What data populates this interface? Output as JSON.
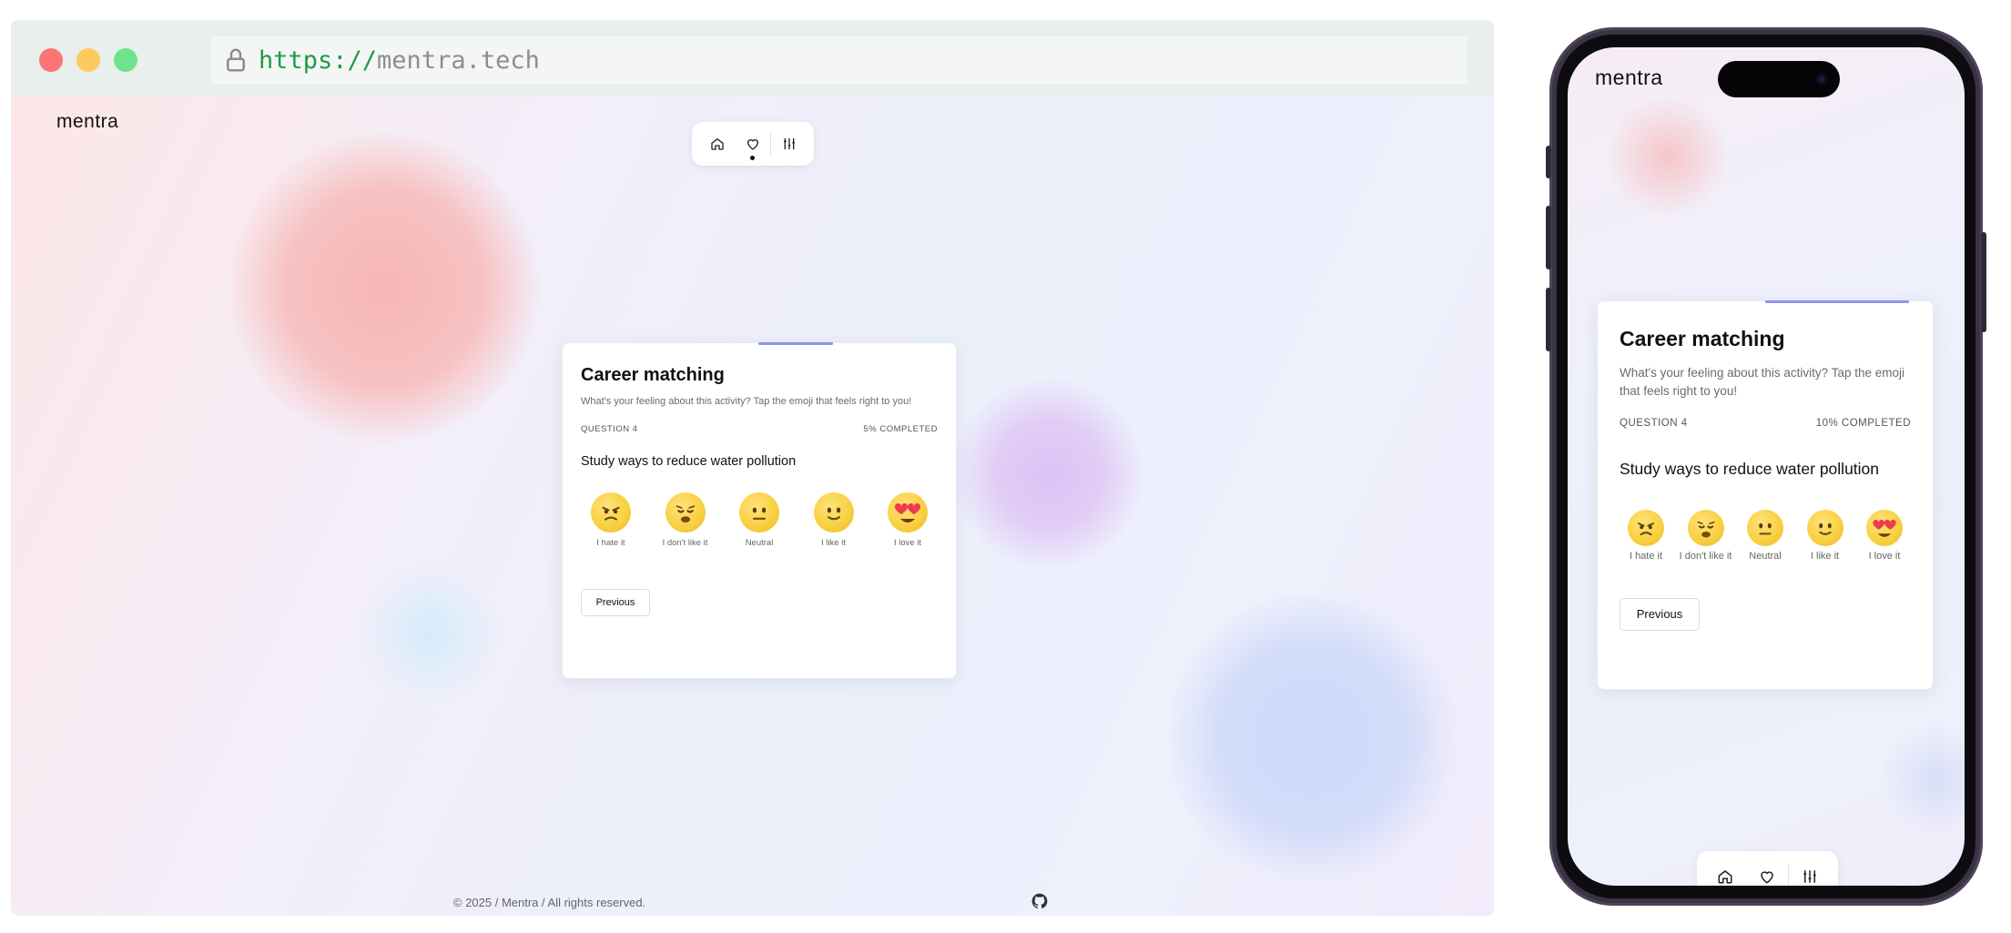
{
  "browser": {
    "url_scheme": "https://",
    "url_host": "mentra.tech"
  },
  "app": {
    "logo": "mentra",
    "nav": [
      {
        "name": "home",
        "icon": "home-icon"
      },
      {
        "name": "favorites",
        "icon": "heart-icon",
        "active": true
      },
      {
        "name": "settings",
        "icon": "sliders-icon"
      }
    ],
    "footer": "© 2025 / Mentra / All rights reserved."
  },
  "desktop_card": {
    "title": "Career matching",
    "description": "What's your feeling about this activity? Tap the emoji that feels right to you!",
    "question_label": "QUESTION 4",
    "progress_label": "5% COMPLETED",
    "progress": 0.05,
    "question": "Study ways to reduce water pollution",
    "previous_label": "Previous"
  },
  "mobile_card": {
    "title": "Career matching",
    "description": "What's your feeling about this activity? Tap the emoji that feels right to you!",
    "question_label": "QUESTION 4",
    "progress_label": "10% COMPLETED",
    "progress": 0.1,
    "question": "Study ways to reduce water pollution",
    "previous_label": "Previous"
  },
  "emojis": [
    {
      "label": "I hate it",
      "icon": "angry-face-icon"
    },
    {
      "label": "I don't like it",
      "icon": "tired-face-icon"
    },
    {
      "label": "Neutral",
      "icon": "neutral-face-icon"
    },
    {
      "label": "I like it",
      "icon": "slight-smile-icon"
    },
    {
      "label": "I love it",
      "icon": "heart-eyes-icon"
    }
  ],
  "colors": {
    "accent": "#8c95e8",
    "url_scheme": "#1e9c44",
    "emoji_yellow": "#f8cf3e"
  }
}
